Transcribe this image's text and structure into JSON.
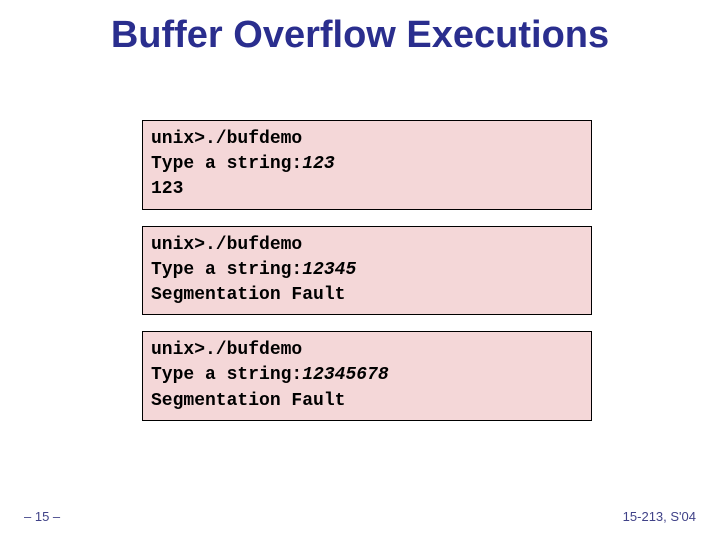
{
  "title": "Buffer Overflow Executions",
  "runs": [
    {
      "prompt": "unix>./bufdemo",
      "type_label": "Type a string:",
      "input": "123",
      "output": "123"
    },
    {
      "prompt": "unix>./bufdemo",
      "type_label": "Type a string:",
      "input": "12345",
      "output": "Segmentation Fault"
    },
    {
      "prompt": "unix>./bufdemo",
      "type_label": "Type a string:",
      "input": "12345678",
      "output": "Segmentation Fault"
    }
  ],
  "footer_left": "– 15 –",
  "footer_right": "15-213, S'04"
}
